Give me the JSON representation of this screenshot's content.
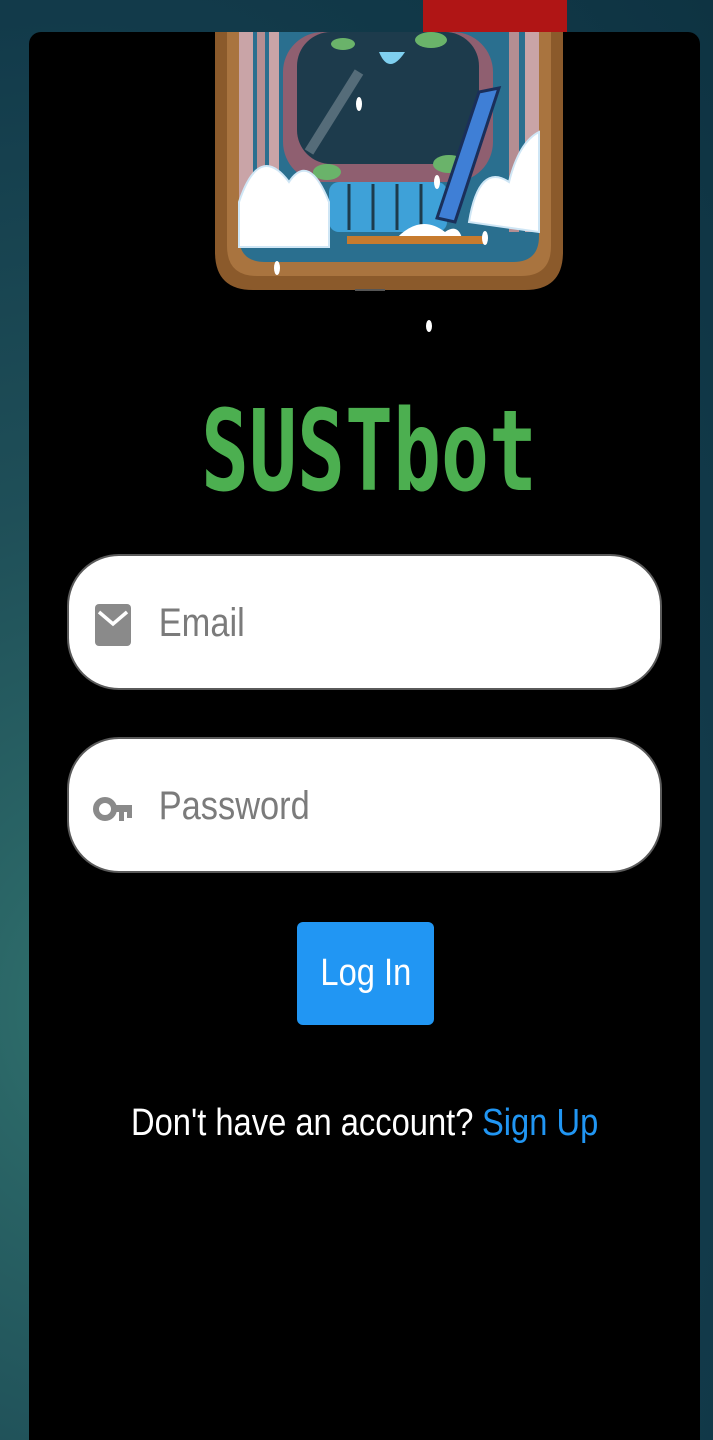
{
  "colors": {
    "card_background": "#000000",
    "accent_red": "#b01515",
    "brand_green": "#4caf50",
    "primary_blue": "#2196f3"
  },
  "logo": {
    "text": "SUSTbot"
  },
  "login_form": {
    "email": {
      "placeholder": "Email",
      "value": "",
      "icon": "envelope-icon"
    },
    "password": {
      "placeholder": "Password",
      "value": "",
      "icon": "key-icon"
    },
    "login_button_label": "Log In"
  },
  "signup": {
    "prompt": "Don't have an account?",
    "link_label": "Sign Up"
  }
}
